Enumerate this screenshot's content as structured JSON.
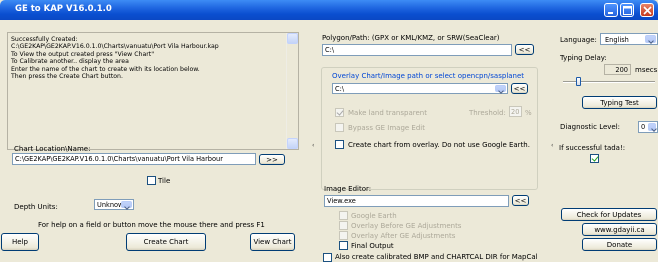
{
  "window": {
    "title": "GE to KAP V16.0.1.0"
  },
  "left": {
    "log_lines": [
      "Successfully Created:",
      "C:\\GE2KAP\\GE2KAP.V16.0.1.0\\Charts\\vanuatu\\Port Vila Harbour.kap",
      "To View the output created press \"View Chart\"",
      "To Calibrate another.. display the area",
      "Enter the name of the chart to create with its location below.",
      "Then press the Create Chart button."
    ],
    "chart_location_label": "Chart Location\\Name:",
    "chart_location_value": "C:\\GE2KAP\\GE2KAP.V16.0.1.0\\Charts\\vanuatu\\Port Vila Harbour",
    "browse_label": ">>",
    "tile_label": "Tile",
    "depth_units_label": "Depth Units:",
    "depth_units_value": "Unknown",
    "help_text": "For help on a field or button move the mouse there and press F1",
    "help_button": "Help",
    "create_chart_button": "Create Chart",
    "view_chart_button": "View Chart"
  },
  "middle": {
    "polygon_label": "Polygon/Path: (GPX or KML/KMZ, or SRW(SeaClear)",
    "polygon_value": "C:\\",
    "polygon_browse": "<<",
    "overlay_group_label": "Overlay Chart/Image path or select opencpn/sasplanet",
    "overlay_value": "C:\\",
    "overlay_browse": "<<",
    "make_transparent_label": "Make land transparent",
    "threshold_label": "Threshold:",
    "threshold_value": "20",
    "threshold_unit": "%",
    "bypass_label": "Bypass GE Image Edit",
    "create_from_overlay_label": "Create chart from overlay. Do not use Google Earth.",
    "image_editor_label": "Image Editor:",
    "image_editor_value": "View.exe",
    "image_editor_browse": "<<",
    "google_earth_label": "Google Earth",
    "overlay_before_label": "Overlay Before GE Adjustments",
    "overlay_after_label": "Overlay After GE Adjustments",
    "final_output_label": "Final Output",
    "also_create_label": "Also create calibrated BMP and CHARTCAL DIR for MapCal"
  },
  "right": {
    "language_label": "Language:",
    "language_value": "English",
    "typing_delay_label": "Typing Delay:",
    "typing_delay_value": "200",
    "typing_delay_unit": "msecs",
    "typing_delay_level": 0.15,
    "typing_test_button": "Typing Test",
    "diagnostic_label": "Diagnostic Level:",
    "diagnostic_value": "0",
    "tada_label": "If successful tada!:",
    "check_updates_button": "Check for Updates",
    "website_button": "www.gdayii.ca",
    "donate_button": "Donate"
  },
  "colors": {
    "titlebar": "#0a4fd0",
    "face": "#ece9d8",
    "input_border": "#7f9db9"
  }
}
